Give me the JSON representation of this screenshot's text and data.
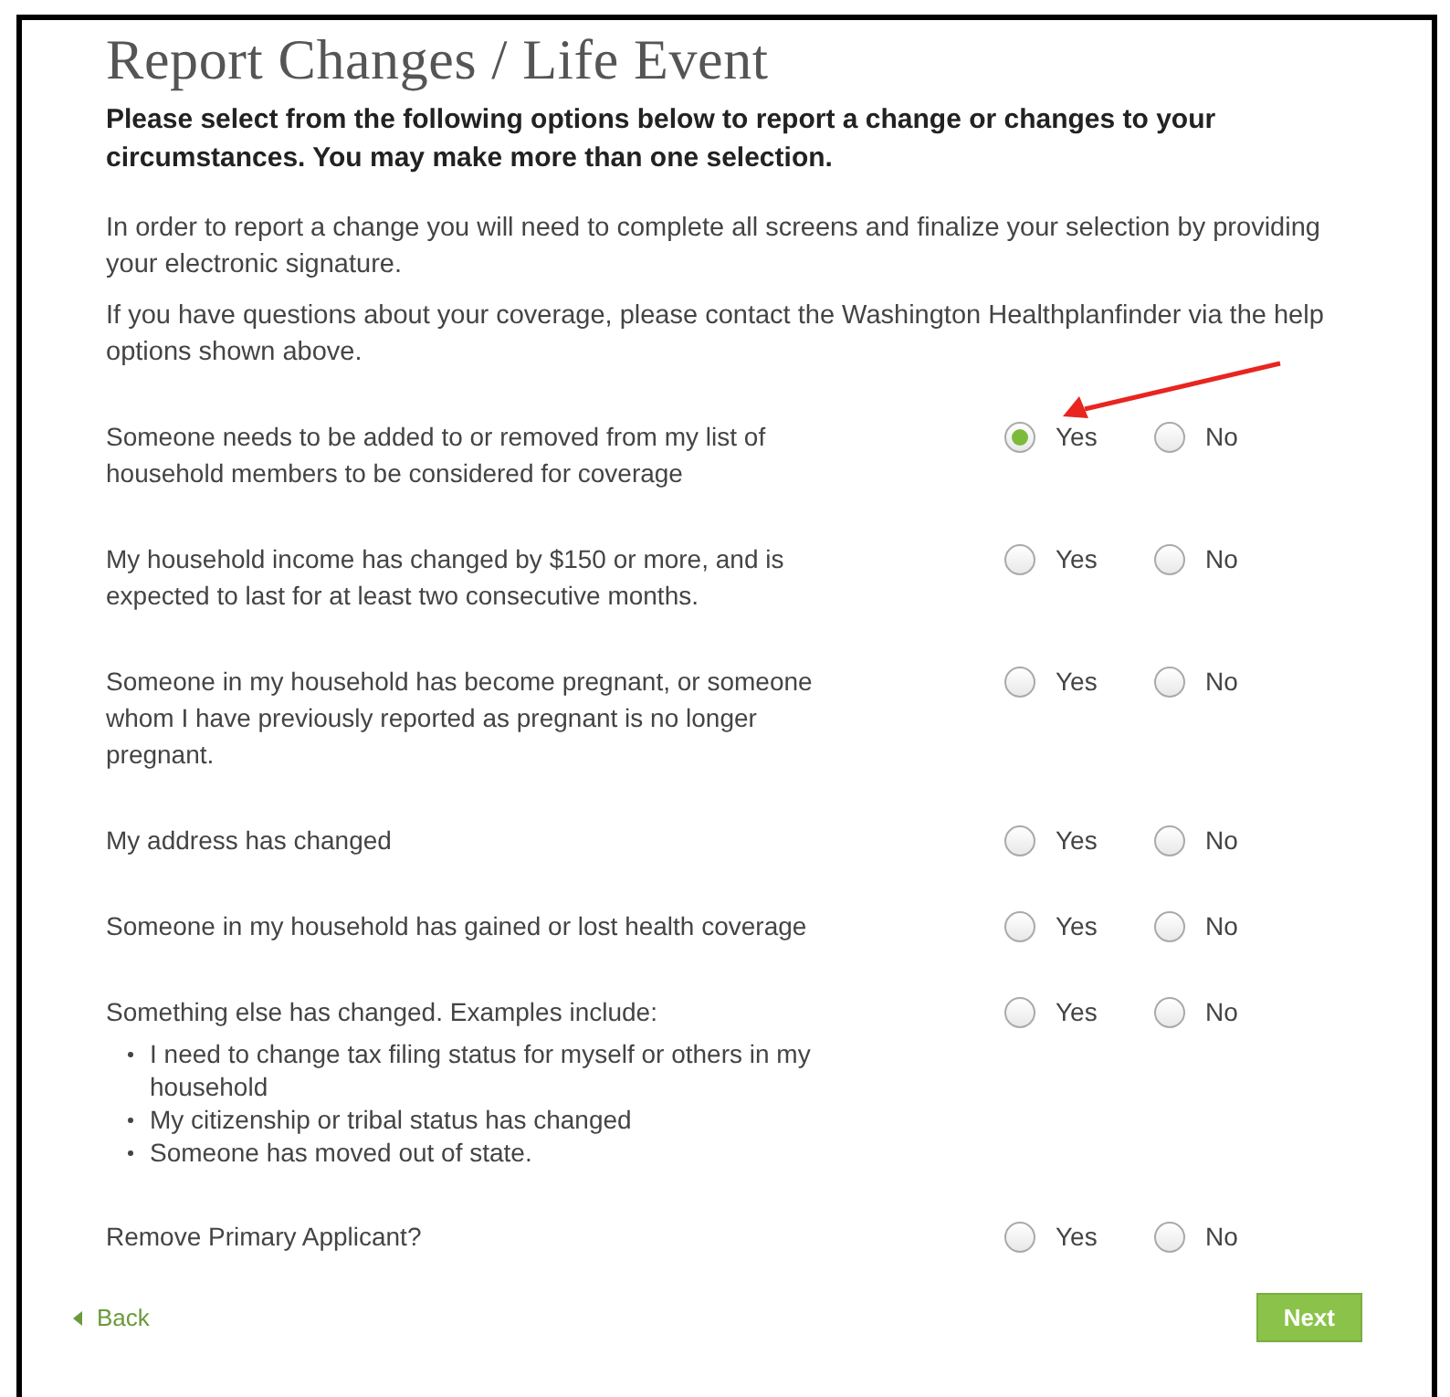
{
  "title": "Report Changes / Life Event",
  "intro": "Please select from the following options below to report a change or changes to your circumstances. You may make more than one selection.",
  "paragraphs": [
    "In order to report a change you will need to complete all screens and finalize your selection by providing your electronic signature.",
    "If you have questions about your coverage, please contact the Washington Healthplanfinder via the help options shown above."
  ],
  "questions": [
    {
      "text": "Someone needs to be added to or removed from my list of household members to be considered for coverage",
      "options": [
        {
          "label": "Yes",
          "selected": true
        },
        {
          "label": "No",
          "selected": false
        }
      ]
    },
    {
      "text": "My household income has changed by $150 or more, and is expected to last for at least two consecutive months.",
      "options": [
        {
          "label": "Yes",
          "selected": false
        },
        {
          "label": "No",
          "selected": false
        }
      ]
    },
    {
      "text": "Someone in my household has become pregnant, or someone whom I have previously reported as pregnant is no longer pregnant.",
      "options": [
        {
          "label": "Yes",
          "selected": false
        },
        {
          "label": "No",
          "selected": false
        }
      ]
    },
    {
      "text": "My address has changed",
      "options": [
        {
          "label": "Yes",
          "selected": false
        },
        {
          "label": "No",
          "selected": false
        }
      ]
    },
    {
      "text": "Someone in my household has gained or lost health coverage",
      "options": [
        {
          "label": "Yes",
          "selected": false
        },
        {
          "label": "No",
          "selected": false
        }
      ]
    },
    {
      "text": "Something else has changed. Examples include:",
      "bullets": [
        "I need to change tax filing status for myself or others in my household",
        "My citizenship or tribal status has changed",
        "Someone has moved out of state."
      ],
      "options": [
        {
          "label": "Yes",
          "selected": false
        },
        {
          "label": "No",
          "selected": false
        }
      ]
    },
    {
      "text": "Remove Primary Applicant?",
      "options": [
        {
          "label": "Yes",
          "selected": false
        },
        {
          "label": "No",
          "selected": false
        }
      ]
    }
  ],
  "back": "Back",
  "next": "Next"
}
